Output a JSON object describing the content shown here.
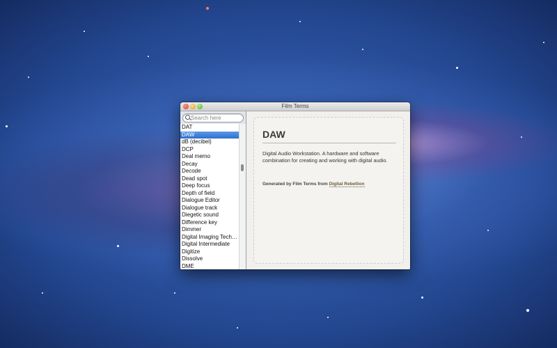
{
  "window": {
    "title": "Film Terms"
  },
  "search": {
    "placeholder": "Search here"
  },
  "list": {
    "items": [
      "DAT",
      "DAW",
      "dB (decibel)",
      "DCP",
      "Deal memo",
      "Decay",
      "Decode",
      "Dead spot",
      "Deep focus",
      "Depth of field",
      "Dialogue Editor",
      "Dialogue track",
      "Diegetic sound",
      "Difference key",
      "Dimmer",
      "Digital Imaging Tech…",
      "Digital Intermediate",
      "Digitize",
      "Dissolve",
      "DME"
    ],
    "selected_index": 1
  },
  "detail": {
    "term": "DAW",
    "definition": "Digital Audio Workstation. A hardware and software combination for creating and working with digital audio.",
    "generated_prefix": "Generated by Film Terms from",
    "generated_link": "Digital Rebellion"
  },
  "colors": {
    "selection": "#2f6fcf",
    "sidebar_bg": "#dfe5ee",
    "content_bg": "#f1f0ec"
  },
  "icons": {
    "search": "search-icon",
    "close": "close-icon",
    "minimize": "minimize-icon",
    "zoom": "zoom-icon"
  }
}
